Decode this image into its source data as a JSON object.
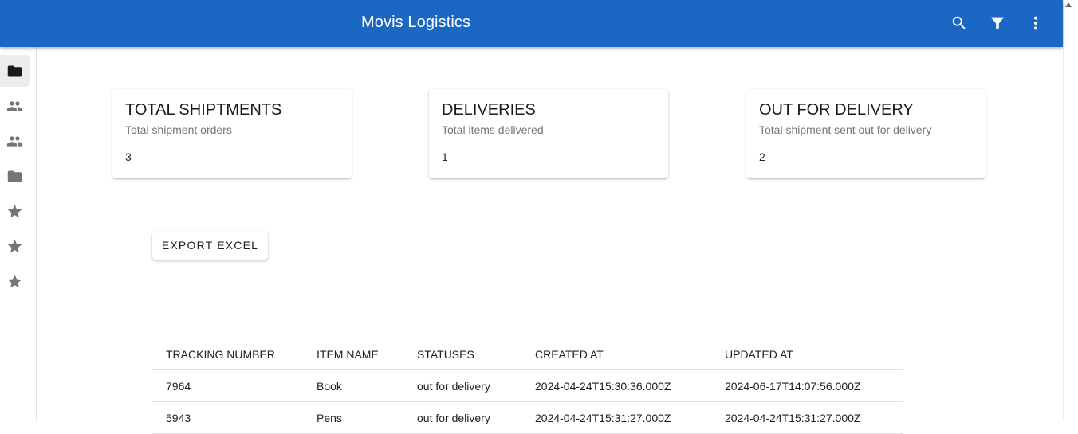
{
  "app": {
    "title": "Movis Logistics"
  },
  "toolbar": {
    "icons": [
      "search-icon",
      "filter-icon",
      "more-vert-icon"
    ]
  },
  "sidebar": {
    "items": [
      {
        "icon": "folder-icon",
        "active": true
      },
      {
        "icon": "people-icon",
        "active": false
      },
      {
        "icon": "people-icon",
        "active": false
      },
      {
        "icon": "folder-icon",
        "active": false
      },
      {
        "icon": "star-icon",
        "active": false
      },
      {
        "icon": "star-icon",
        "active": false
      },
      {
        "icon": "star-icon",
        "active": false
      }
    ]
  },
  "cards": [
    {
      "title": "TOTAL SHIPTMENTS",
      "subtitle": "Total shipment orders",
      "value": "3"
    },
    {
      "title": "DELIVERIES",
      "subtitle": "Total items delivered",
      "value": "1"
    },
    {
      "title": "OUT FOR DELIVERY",
      "subtitle": "Total shipment sent out for delivery",
      "value": "2"
    }
  ],
  "export": {
    "label": "EXPORT EXCEL"
  },
  "table": {
    "headers": [
      "TRACKING NUMBER",
      "ITEM NAME",
      "STATUSES",
      "CREATED AT",
      "UPDATED AT"
    ],
    "rows": [
      [
        "7964",
        "Book",
        "out for delivery",
        "2024-04-24T15:30:36.000Z",
        "2024-06-17T14:07:56.000Z"
      ],
      [
        "5943",
        "Pens",
        "out for delivery",
        "2024-04-24T15:31:27.000Z",
        "2024-04-24T15:31:27.000Z"
      ]
    ]
  }
}
